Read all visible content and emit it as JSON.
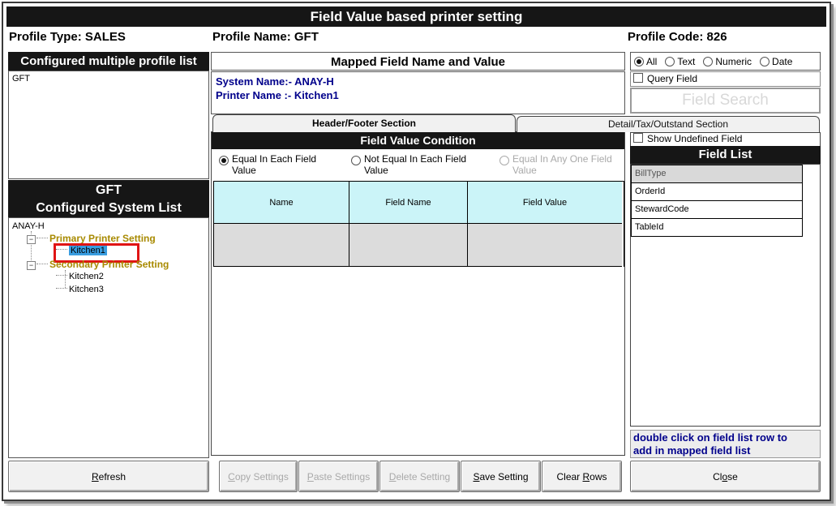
{
  "window": {
    "title": "Field Value based printer setting"
  },
  "header": {
    "profile_type_label": "Profile Type:",
    "profile_type_value": "SALES",
    "profile_name_label": "Profile Name:",
    "profile_name_value": "GFT",
    "profile_code_label": "Profile Code:",
    "profile_code_value": "826"
  },
  "left_panel": {
    "profile_list_title": "Configured multiple profile list",
    "profile_items": [
      "GFT"
    ],
    "system_list_title_line1": "GFT",
    "system_list_title_line2": "Configured System List",
    "tree": {
      "root": "ANAY-H",
      "groups": [
        {
          "label": "Primary Printer Setting",
          "children": [
            "Kitchen1"
          ]
        },
        {
          "label": "Secondary Printer Setting",
          "children": [
            "Kitchen2",
            "Kitchen3"
          ]
        }
      ],
      "selected_item": "Kitchen1"
    }
  },
  "mapped_panel": {
    "title": "Mapped Field Name and Value",
    "system_name_label": "System Name:-",
    "system_name_value": "ANAY-H",
    "printer_name_label": "Printer Name :-",
    "printer_name_value": "Kitchen1",
    "tabs": [
      {
        "label": "Header/Footer Section",
        "active": true
      },
      {
        "label": "Detail/Tax/Outstand Section",
        "active": false
      }
    ],
    "condition_title": "Field Value Condition",
    "conditions": [
      {
        "label": "Equal In Each Field Value",
        "selected": true,
        "enabled": true
      },
      {
        "label": "Not Equal In Each Field Value",
        "selected": false,
        "enabled": true
      },
      {
        "label": "Equal In Any One Field Value",
        "selected": false,
        "enabled": false
      }
    ],
    "grid": {
      "columns": [
        "Name",
        "Field Name",
        "Field Value"
      ],
      "rows": [
        [
          "",
          "",
          ""
        ]
      ]
    }
  },
  "right_panel": {
    "type_filters": [
      {
        "label": "All",
        "selected": true
      },
      {
        "label": "Text",
        "selected": false
      },
      {
        "label": "Numeric",
        "selected": false
      },
      {
        "label": "Date",
        "selected": false
      }
    ],
    "query_field_label": "Query Field",
    "field_search_placeholder": "Field Search",
    "show_undefined_label": "Show Undefined Field",
    "field_list_title": "Field List",
    "field_list_rows": [
      "BillType",
      "OrderId",
      "StewardCode",
      "TableId"
    ],
    "hint_line1": "double click on field list row to",
    "hint_line2": "add in mapped field list"
  },
  "buttons": {
    "refresh": {
      "label": "Refresh",
      "accel": "R",
      "enabled": true
    },
    "copy": {
      "label": "Copy Settings",
      "accel": "C",
      "enabled": false
    },
    "paste": {
      "label": "Paste Settings",
      "accel": "P",
      "enabled": false
    },
    "delete": {
      "label": "Delete Setting",
      "accel": "D",
      "enabled": false
    },
    "save": {
      "label": "Save Setting",
      "accel": "S",
      "enabled": true
    },
    "clear": {
      "label": "Clear Rows",
      "accel": "R",
      "enabled": true
    },
    "close": {
      "label": "Close",
      "accel": "o",
      "enabled": true
    }
  },
  "colors": {
    "header_bg": "#161616",
    "info_text": "#00008b",
    "grid_header_bg": "#cbf4f8",
    "grid_empty_row_bg": "#dcdcdc",
    "tree_group_text": "#a88a00",
    "tree_selection_bg": "#399de0",
    "annotation_red": "#e01414",
    "hint_bg": "#ededed",
    "disabled_text": "#a9a9a9"
  }
}
